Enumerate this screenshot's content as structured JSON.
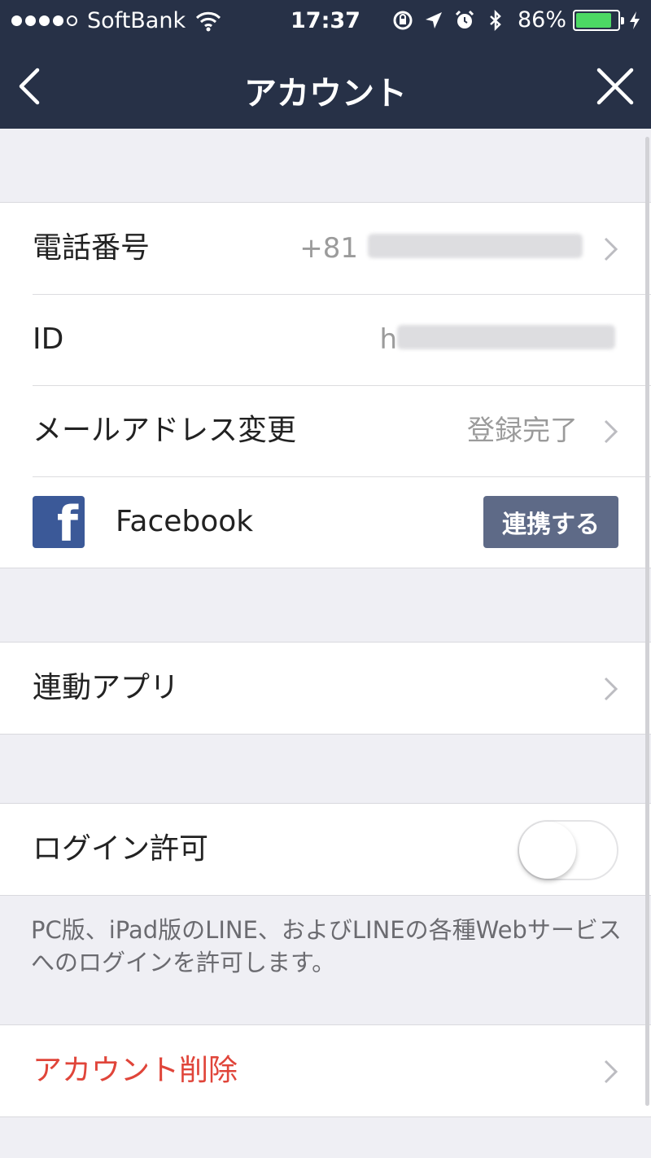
{
  "status_bar": {
    "carrier": "SoftBank",
    "time": "17:37",
    "battery_percent": "86%",
    "battery_level": 0.86,
    "icons": [
      "signal-dots-icon",
      "wifi-icon",
      "lock-rotation-icon",
      "location-arrow-icon",
      "alarm-icon",
      "bluetooth-icon",
      "battery-icon",
      "charging-bolt-icon"
    ]
  },
  "nav": {
    "title": "アカウント",
    "back_icon": "chevron-left-icon",
    "close_icon": "close-icon"
  },
  "account": {
    "phone_label": "電話番号",
    "phone_value": "+81",
    "id_label": "ID",
    "id_value": "h",
    "email_label": "メールアドレス変更",
    "email_value": "登録完了",
    "facebook_label": "Facebook",
    "facebook_logo": "f",
    "facebook_button": "連携する"
  },
  "apps": {
    "label": "連動アプリ"
  },
  "login": {
    "label": "ログイン許可",
    "enabled": false,
    "note": "PC版、iPad版のLINE、およびLINEの各種Webサービスへのログインを許可します。"
  },
  "delete": {
    "label": "アカウント削除"
  },
  "colors": {
    "navbar": "#273147",
    "background": "#efeff4",
    "danger": "#e0453a",
    "facebook": "#3b5998",
    "button": "#5e6a87",
    "battery_fill": "#4cd964"
  }
}
